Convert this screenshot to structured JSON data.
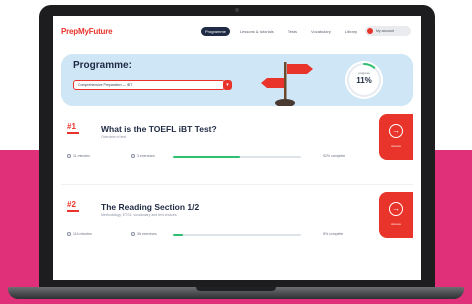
{
  "brand": {
    "name": "PrepMyFuture"
  },
  "nav": {
    "links": [
      {
        "label": "Programme",
        "active": true
      },
      {
        "label": "Lessons & tutorials",
        "active": false
      },
      {
        "label": "Tests",
        "active": false
      },
      {
        "label": "Vocabulary",
        "active": false
      },
      {
        "label": "Library",
        "active": false
      }
    ],
    "user": {
      "name": "My account"
    }
  },
  "hero": {
    "title": "Programme:",
    "select_value": "Comprehensive Preparation — iBT",
    "progress": {
      "caption": "progress",
      "value": "11%",
      "fraction": 0.11
    }
  },
  "lessons": [
    {
      "number": "#1",
      "title": "What is the TOEFL iBT Test?",
      "subtitle": "Overview of test",
      "duration": "11 minutes",
      "exercises": "3 exercises",
      "progress_fraction": 0.52,
      "progress_label": "52% complete",
      "action_label": "Access"
    },
    {
      "number": "#2",
      "title": "The Reading Section 1/2",
      "subtitle": "Methodology, ETS1: vocabulary and text choices",
      "duration": "114 minutes",
      "exercises": "36 exercises",
      "progress_fraction": 0.08,
      "progress_label": "8% complete",
      "action_label": "Access"
    }
  ],
  "colors": {
    "accent": "#e8342a",
    "navy": "#1f2a44",
    "hero_bg": "#cfe6f6",
    "progress_green": "#2fbf71",
    "pink": "#e0307a"
  }
}
